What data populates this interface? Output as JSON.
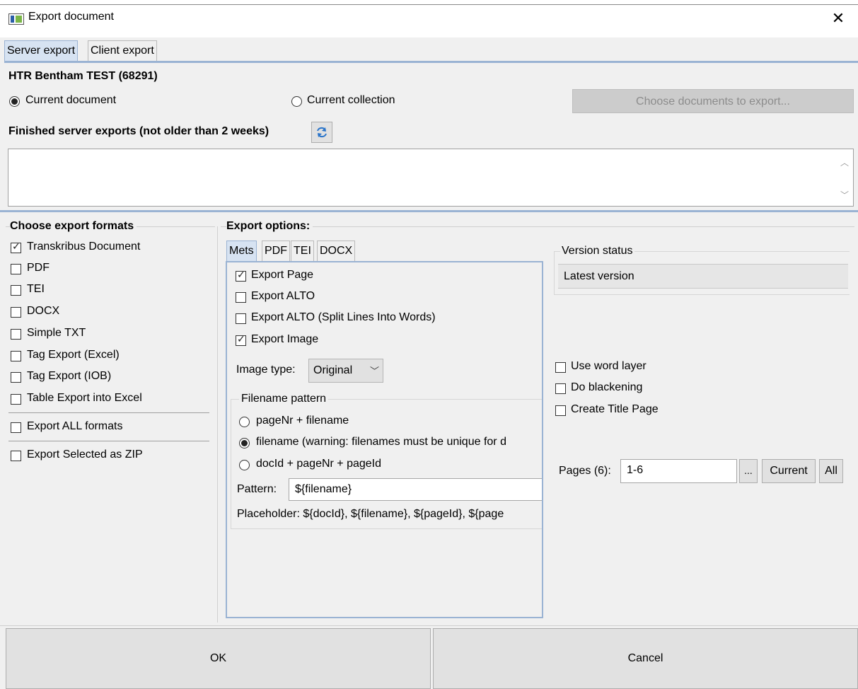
{
  "window": {
    "title": "Export document",
    "icon": "app-icon",
    "close": "close-icon"
  },
  "tabs": [
    "Server export",
    "Client export"
  ],
  "doc_title": "HTR Bentham TEST (68291)",
  "scope": {
    "current_document": "Current document",
    "current_collection": "Current collection",
    "choose_button": "Choose documents to export..."
  },
  "finished_label": "Finished server exports (not older than 2 weeks)",
  "formats": {
    "title": "Choose export formats",
    "items": [
      {
        "label": "Transkribus Document",
        "checked": true
      },
      {
        "label": "PDF",
        "checked": false
      },
      {
        "label": "TEI",
        "checked": false
      },
      {
        "label": "DOCX",
        "checked": false
      },
      {
        "label": "Simple TXT",
        "checked": false
      },
      {
        "label": "Tag Export (Excel)",
        "checked": false
      },
      {
        "label": "Tag Export (IOB)",
        "checked": false
      },
      {
        "label": "Table Export into Excel",
        "checked": false
      }
    ],
    "export_all": "Export ALL formats",
    "export_zip": "Export Selected as ZIP"
  },
  "options": {
    "title": "Export options:",
    "subtabs": [
      "Mets",
      "PDF",
      "TEI",
      "DOCX"
    ],
    "checks": [
      {
        "label": "Export Page",
        "checked": true
      },
      {
        "label": "Export ALTO",
        "checked": false
      },
      {
        "label": "Export ALTO (Split Lines Into Words)",
        "checked": false
      },
      {
        "label": "Export Image",
        "checked": true
      }
    ],
    "image_type_label": "Image type:",
    "image_type_value": "Original",
    "filename_pattern_legend": "Filename pattern",
    "patterns": [
      {
        "label": "pageNr + filename",
        "selected": false
      },
      {
        "label": "filename (warning: filenames must be unique for d",
        "selected": true
      },
      {
        "label": "docId + pageNr + pageId",
        "selected": false
      }
    ],
    "pattern_label": "Pattern:",
    "pattern_value": "${filename}",
    "placeholder_text": "Placeholder: ${docId}, ${filename}, ${pageId}, ${page"
  },
  "version": {
    "legend": "Version status",
    "value": "Latest version"
  },
  "right_checks": [
    {
      "label": "Use word layer",
      "checked": false
    },
    {
      "label": "Do blackening",
      "checked": false
    },
    {
      "label": "Create Title Page",
      "checked": false
    }
  ],
  "pages": {
    "label": "Pages (6):",
    "value": "1-6",
    "dots": "...",
    "current": "Current",
    "all": "All"
  },
  "buttons": {
    "ok": "OK",
    "cancel": "Cancel"
  }
}
